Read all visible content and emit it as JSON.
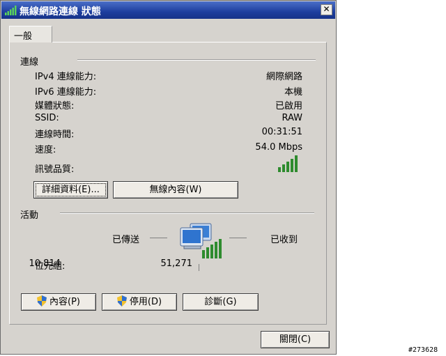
{
  "window": {
    "title": "無線網路連線 狀態",
    "close_symbol": "✕",
    "close_button_label": "關閉(C)"
  },
  "tab": {
    "label": "一般"
  },
  "connection": {
    "heading": "連線",
    "rows": [
      {
        "label": "IPv4 連線能力:",
        "value": "網際網路"
      },
      {
        "label": "IPv6 連線能力:",
        "value": "本機"
      },
      {
        "label": "媒體狀態:",
        "value": "已啟用"
      },
      {
        "label": "SSID:",
        "value": "RAW"
      },
      {
        "label": "連線時間:",
        "value": "00:31:51"
      },
      {
        "label": "速度:",
        "value": "54.0 Mbps"
      }
    ],
    "signal_label": "訊號品質:",
    "signal_bars": 5,
    "details_button": "詳細資料(E)...",
    "wireless_props_button": "無線內容(W)"
  },
  "activity": {
    "heading": "活動",
    "sent_label": "已傳送",
    "received_label": "已收到",
    "bytes_label": "位元組:",
    "bytes_sent": "10,814",
    "bytes_received": "51,271"
  },
  "buttons": {
    "properties": "內容(P)",
    "disable": "停用(D)",
    "diagnose": "診斷(G)"
  },
  "colors": {
    "title_bar": "#1d3e9e",
    "signal": "#2e8b2e",
    "dialog_bg": "#d6d3ce"
  },
  "corner_id": "#273628"
}
